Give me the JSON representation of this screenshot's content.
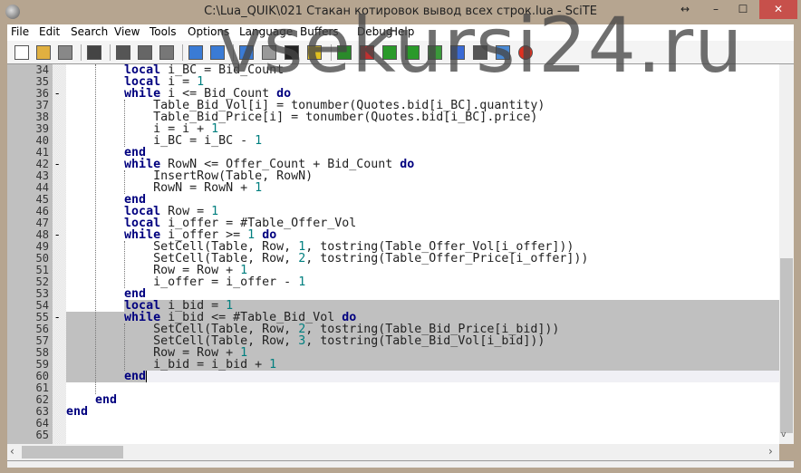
{
  "window": {
    "title": "C:\\Lua_QUIK\\021 Стакан котировок вывод всех строк.lua - SciTE",
    "resize": "↔",
    "minimize": "–",
    "maximize": "☐",
    "close": "✕"
  },
  "menu": [
    "File",
    "Edit",
    "Search",
    "View",
    "Tools",
    "Options",
    "Language",
    "Buffers",
    "Debug",
    "Help"
  ],
  "toolbar": [
    "new-file-icon",
    "open-folder-icon",
    "save-icon",
    "|",
    "print-icon",
    "|",
    "cut-icon",
    "copy-icon",
    "paste-icon",
    "|",
    "find-icon",
    "replace-icon",
    "|",
    "run-icon",
    "stop-icon",
    "console-icon",
    "build-icon",
    "|",
    "debug-bug-icon",
    "breakpoint-flag-icon",
    "step-over-icon",
    "step-into-icon",
    "step-out-icon",
    "watch-eye-icon",
    "locals-icon",
    "trace-icon",
    "stop-debug-icon"
  ],
  "watermark": "vsekursi24.ru",
  "editor": {
    "first_line": 34,
    "fold_marker": "-",
    "fold_lines": [
      36,
      42,
      48,
      55
    ],
    "lines": [
      "        local i_BC = Bid_Count",
      "        local i = 1",
      "        while i <= Bid_Count do",
      "            Table_Bid_Vol[i] = tonumber(Quotes.bid[i_BC].quantity)",
      "            Table_Bid_Price[i] = tonumber(Quotes.bid[i_BC].price)",
      "            i = i + 1",
      "            i_BC = i_BC - 1",
      "        end",
      "        while RowN <= Offer_Count + Bid_Count do",
      "            InsertRow(Table, RowN)",
      "            RowN = RowN + 1",
      "        end",
      "        local Row = 1",
      "        local i_offer = #Table_Offer_Vol",
      "        while i_offer >= 1 do",
      "            SetCell(Table, Row, 1, tostring(Table_Offer_Vol[i_offer]))",
      "            SetCell(Table, Row, 2, tostring(Table_Offer_Price[i_offer]))",
      "            Row = Row + 1",
      "            i_offer = i_offer - 1",
      "        end",
      "        local i_bid = 1",
      "        while i_bid <= #Table_Bid_Vol do",
      "            SetCell(Table, Row, 2, tostring(Table_Bid_Price[i_bid]))",
      "            SetCell(Table, Row, 3, tostring(Table_Bid_Vol[i_bid]))",
      "            Row = Row + 1",
      "            i_bid = i_bid + 1",
      "        end",
      "",
      "    end",
      "end",
      "",
      ""
    ],
    "selection": {
      "from_line": 54,
      "from_col": 8,
      "to_line": 60,
      "to_col": 11
    },
    "caret": {
      "line": 60,
      "col": 11
    },
    "colors": {
      "keyword": "#00007f",
      "number": "#007f7f",
      "selection": "#c0c0c0"
    }
  },
  "scrollbars": {
    "v_down": "v",
    "h_left": "‹",
    "h_right": "›"
  }
}
